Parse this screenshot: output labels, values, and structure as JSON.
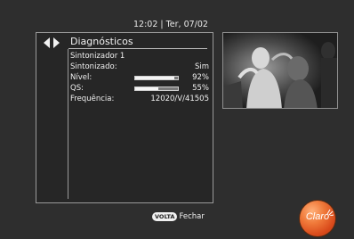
{
  "header": {
    "clock": "12:02 | Ter, 07/02"
  },
  "menu": {
    "title": "Diagnósticos",
    "tuner_label": "Sintonizador 1",
    "rows": [
      {
        "label": "Sintonizado:",
        "value": "Sim"
      },
      {
        "label": "Nível:",
        "value": "92%",
        "level": 92
      },
      {
        "label": "QS:",
        "value": "55%",
        "level": 55
      },
      {
        "label": "Frequência:",
        "value": "12020/V/41505"
      }
    ]
  },
  "footer": {
    "key_label": "VOLTA",
    "action_label": "Fechar"
  },
  "brand": {
    "logo_text": "Claro",
    "accent": "#e2561f"
  },
  "icons": {
    "nav": "left-right-arrows-icon"
  }
}
